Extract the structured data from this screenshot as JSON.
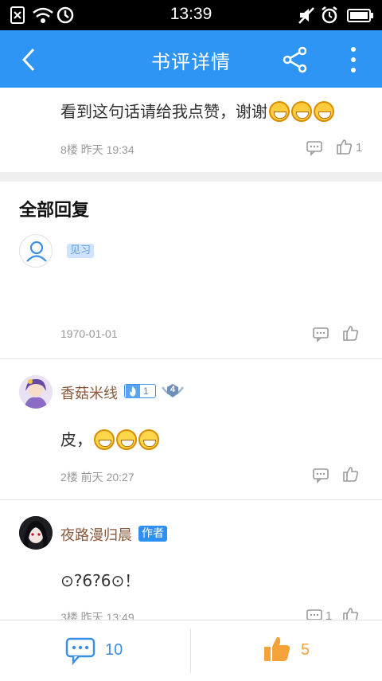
{
  "status_bar": {
    "time": "13:39"
  },
  "header": {
    "title": "书评详情"
  },
  "top_comment": {
    "text": "看到这句话请给我点赞，谢谢",
    "meta": "8楼 昨天 19:34",
    "like_count": "1"
  },
  "replies_section": {
    "heading": "全部回复"
  },
  "replies": [
    {
      "name": "",
      "badge": "见习",
      "text": "",
      "meta": "1970-01-01"
    },
    {
      "name": "香菇米线",
      "fan_level": "1",
      "rank": "4",
      "text": "皮，",
      "meta": "2楼 前天 20:27"
    },
    {
      "name": "夜路漫归晨",
      "badge": "作者",
      "text": "⊙?6?6⊙！",
      "meta": "3楼 昨天 13:49",
      "comment_count": "1"
    }
  ],
  "bottom_bar": {
    "comment_count": "10",
    "like_count": "5"
  },
  "colors": {
    "accent": "#2f95f4",
    "like_orange": "#f5a23a",
    "username": "#8a5b3c"
  }
}
